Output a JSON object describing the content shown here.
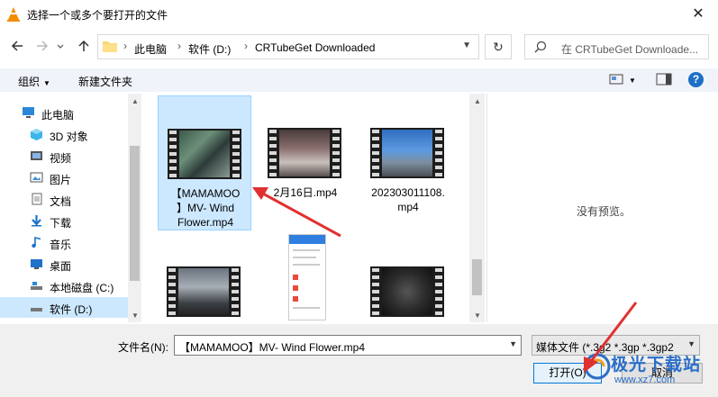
{
  "window": {
    "title": "选择一个或多个要打开的文件",
    "close_icon": "close-icon"
  },
  "nav": {
    "breadcrumbs": [
      "此电脑",
      "软件 (D:)",
      "CRTubeGet Downloaded"
    ],
    "search_placeholder": "在 CRTubeGet Downloade..."
  },
  "toolbar": {
    "organize": "组织",
    "new_folder": "新建文件夹"
  },
  "sidebar": {
    "items": [
      {
        "label": "此电脑",
        "icon": "computer-icon"
      },
      {
        "label": "3D 对象",
        "icon": "cube-icon"
      },
      {
        "label": "视频",
        "icon": "video-icon"
      },
      {
        "label": "图片",
        "icon": "picture-icon"
      },
      {
        "label": "文档",
        "icon": "document-icon"
      },
      {
        "label": "下载",
        "icon": "download-icon"
      },
      {
        "label": "音乐",
        "icon": "music-icon"
      },
      {
        "label": "桌面",
        "icon": "desktop-icon"
      },
      {
        "label": "本地磁盘 (C:)",
        "icon": "drive-icon"
      },
      {
        "label": "软件 (D:)",
        "icon": "drive-icon"
      }
    ],
    "selected_index": 9
  },
  "files": {
    "items": [
      {
        "name_line1": "【MAMAMOO",
        "name_line2": "】MV- Wind",
        "name_line3": "Flower.mp4",
        "selected": true
      },
      {
        "name_line1": "2月16日.mp4",
        "selected": false
      },
      {
        "name_line1": "202303011108.",
        "name_line2": "mp4",
        "selected": false
      }
    ]
  },
  "preview": {
    "text": "没有预览。"
  },
  "bottom": {
    "filename_label": "文件名(N):",
    "filename_value": "【MAMAMOO】MV- Wind Flower.mp4",
    "filetype_value": "媒体文件 (*.3g2 *.3gp *.3gp2",
    "open_button": "打开(O)",
    "cancel_button": "取消"
  },
  "watermark": {
    "text": "极光下载站",
    "url": "www.xz7.com"
  },
  "colors": {
    "selection": "#cce8ff",
    "selection_border": "#99d1ff",
    "annotation_arrow": "#e03131",
    "accent": "#0078d7"
  }
}
